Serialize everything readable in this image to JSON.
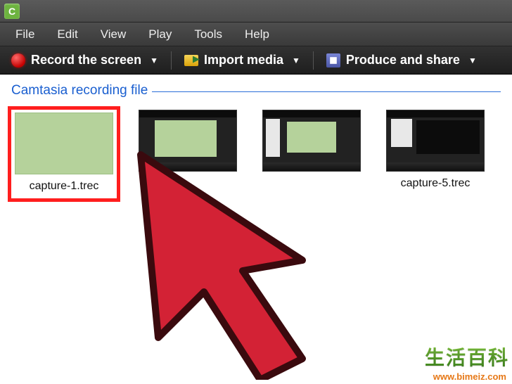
{
  "app": {
    "icon_letter": "C"
  },
  "menu": {
    "items": [
      "File",
      "Edit",
      "View",
      "Play",
      "Tools",
      "Help"
    ]
  },
  "toolbar": {
    "record_label": "Record the screen",
    "import_label": "Import media",
    "produce_label": "Produce and share"
  },
  "section": {
    "title": "Camtasia recording file"
  },
  "files": [
    {
      "label": "capture-1.trec",
      "thumb_type": "green",
      "selected": true
    },
    {
      "label": "",
      "thumb_type": "editor1",
      "selected": false
    },
    {
      "label": "",
      "thumb_type": "editor2",
      "selected": false
    },
    {
      "label": "capture-5.trec",
      "thumb_type": "editor3",
      "selected": false
    }
  ],
  "watermark": {
    "line1": "生活百科",
    "line2": "www.bimeiz.com"
  },
  "colors": {
    "accent": "#1a5fd0",
    "selection": "#ff1e1e",
    "cursor": "#d32235"
  }
}
